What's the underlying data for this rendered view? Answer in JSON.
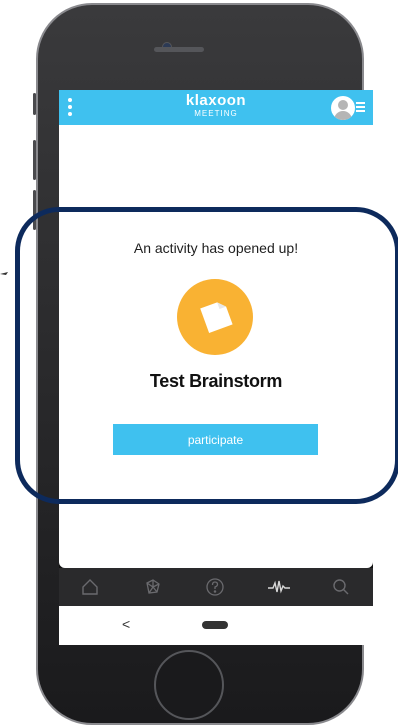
{
  "app": {
    "brand_name": "klaxoon",
    "brand_sub": "MEETING"
  },
  "activity": {
    "prompt": "An activity has opened up!",
    "name": "Test Brainstorm",
    "participate_label": "participate",
    "icon": "note-icon"
  },
  "nav": {
    "items": [
      "home-icon",
      "network-icon",
      "question-icon",
      "pulse-icon",
      "search-icon"
    ]
  },
  "android": {
    "back_label": "<"
  },
  "colors": {
    "accent": "#3fc1ef",
    "activity_icon": "#f9b233",
    "highlight": "#0d2a5c"
  }
}
